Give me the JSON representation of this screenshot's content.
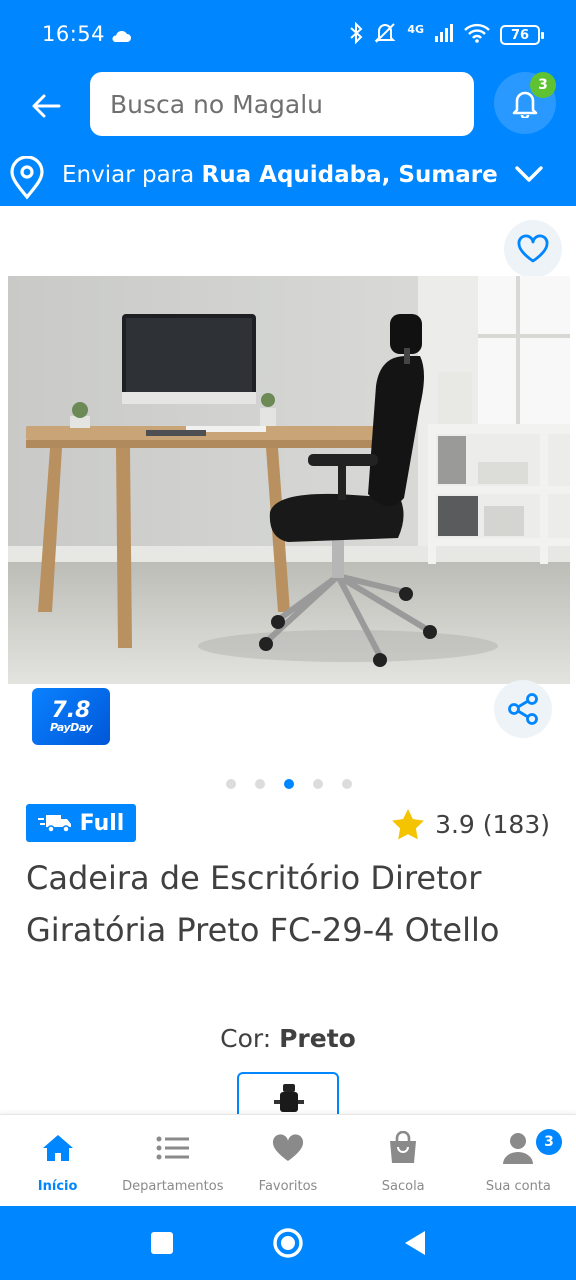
{
  "status_bar": {
    "time": "16:54",
    "network": "4G",
    "battery": "76",
    "icons": [
      "cloud-icon",
      "bluetooth-icon",
      "mute-icon",
      "signal-icon",
      "wifi-icon",
      "battery-icon"
    ]
  },
  "header": {
    "search_placeholder": "Busca no Magalu",
    "notification_count": "3"
  },
  "address": {
    "prefix": "Enviar para ",
    "location": "Rua Aquidaba, Sumare"
  },
  "promo_badge": {
    "number": "7.8",
    "word": "PayDay"
  },
  "gallery": {
    "image_count": 5,
    "active_index": 2
  },
  "product": {
    "shipping_badge": "Full",
    "rating": "3.9 (183)",
    "title": "Cadeira de Escritório Diretor Giratória Preto FC-29-4 Otello",
    "color_label": "Cor: ",
    "color_value": "Preto"
  },
  "bottom_nav": {
    "items": [
      {
        "label": "Início",
        "icon": "home-icon",
        "active": true
      },
      {
        "label": "Departamentos",
        "icon": "menu-icon"
      },
      {
        "label": "Favoritos",
        "icon": "heart-icon"
      },
      {
        "label": "Sacola",
        "icon": "bag-icon"
      },
      {
        "label": "Sua conta",
        "icon": "user-icon",
        "badge": "3"
      }
    ]
  },
  "colors": {
    "brand_blue": "#0086ff",
    "badge_green": "#5ec233",
    "star_yellow": "#f5c400",
    "text": "#404040"
  }
}
